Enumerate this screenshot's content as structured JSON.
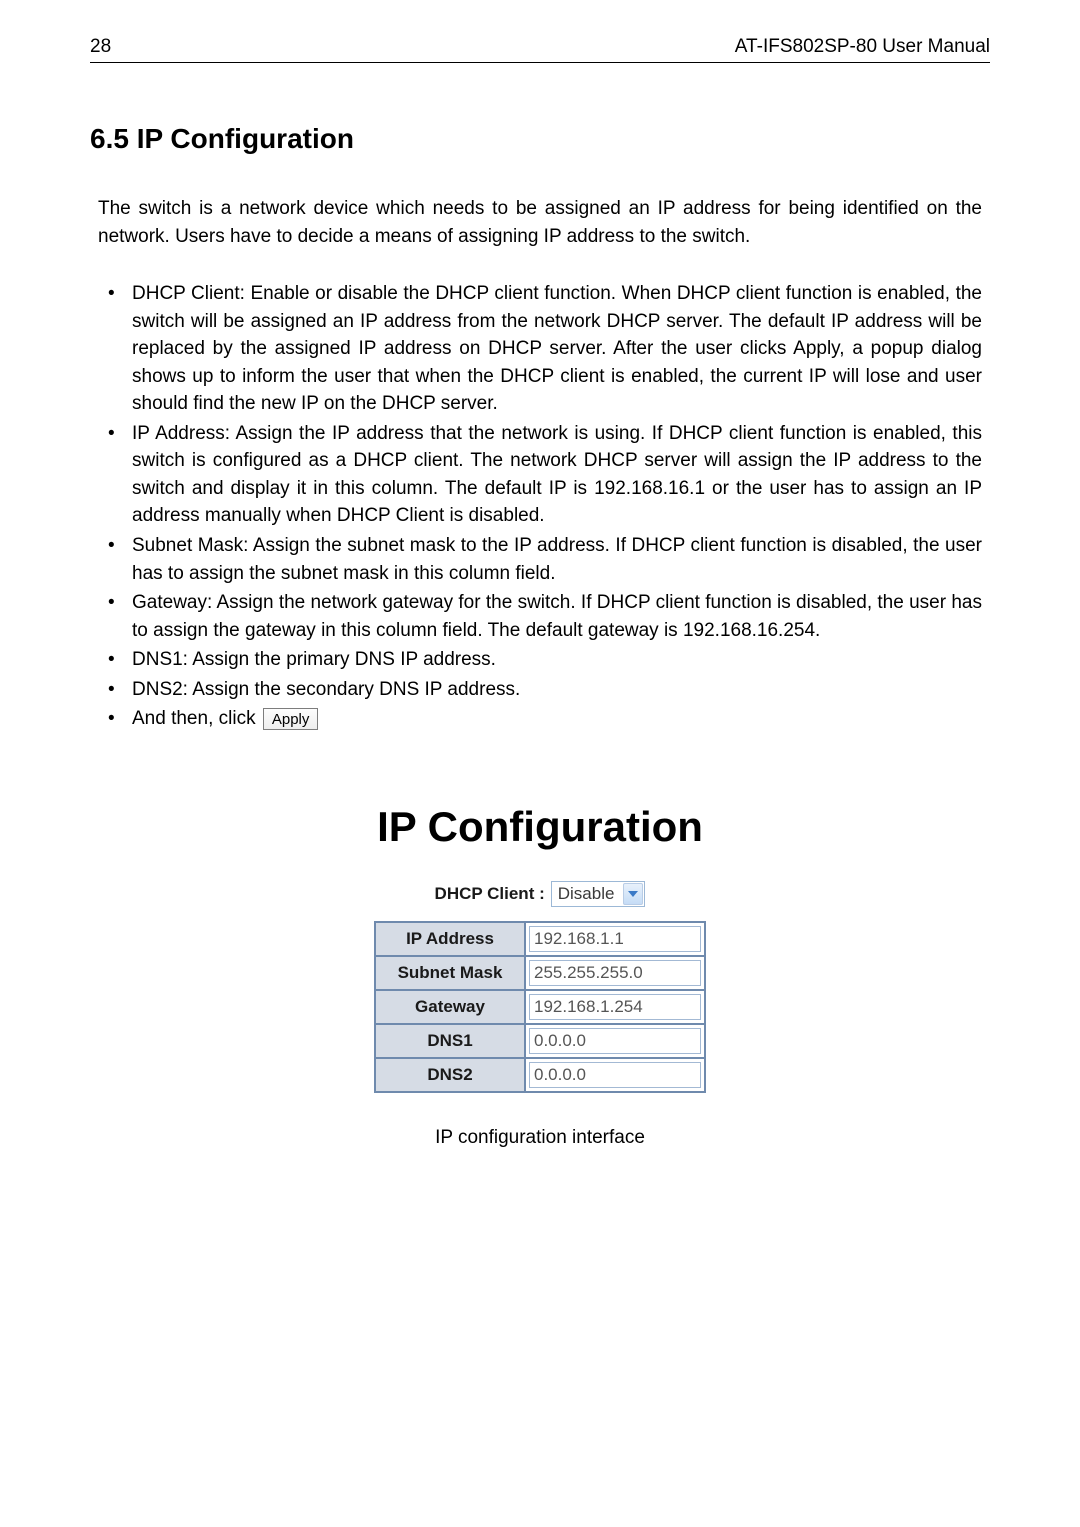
{
  "header": {
    "page_number": "28",
    "manual_title": "AT-IFS802SP-80 User Manual"
  },
  "section": {
    "heading": "6.5  IP Configuration",
    "intro": "The switch is a network device which needs to be assigned an IP address for being identified on the network. Users have to decide a means of assigning IP address to the switch.",
    "bullets": [
      "DHCP Client: Enable or disable the DHCP client function. When DHCP client function is enabled, the switch will be assigned an IP address from the network DHCP server. The default IP address will be replaced by the assigned IP address on DHCP server. After the user clicks Apply, a popup dialog shows up to inform the user that when the DHCP client is enabled, the current IP will lose and user should find the new IP on the DHCP server.",
      "IP Address: Assign the IP address that the network is using. If DHCP client function is enabled, this switch is configured as a DHCP client. The network DHCP server will assign the IP address to the switch and display it in this column. The default IP is 192.168.16.1 or the user has to assign an IP address manually when DHCP Client is disabled.",
      "Subnet Mask: Assign the subnet mask to the IP address. If DHCP client function is disabled, the user has to assign the subnet mask in this column field.",
      "Gateway: Assign the network gateway for the switch. If DHCP client function is disabled, the user has to assign the gateway in this column field. The default gateway is 192.168.16.254.",
      "DNS1: Assign the primary DNS IP address.",
      "DNS2: Assign the secondary DNS IP address."
    ],
    "last_bullet_prefix": "And then, click",
    "apply_button_label": "Apply"
  },
  "figure": {
    "title": "IP Configuration",
    "dhcp_label": "DHCP Client :",
    "dhcp_value": "Disable",
    "rows": {
      "ip_address_label": "IP Address",
      "ip_address_value": "192.168.1.1",
      "subnet_mask_label": "Subnet Mask",
      "subnet_mask_value": "255.255.255.0",
      "gateway_label": "Gateway",
      "gateway_value": "192.168.1.254",
      "dns1_label": "DNS1",
      "dns1_value": "0.0.0.0",
      "dns2_label": "DNS2",
      "dns2_value": "0.0.0.0"
    },
    "caption": "IP configuration interface"
  }
}
